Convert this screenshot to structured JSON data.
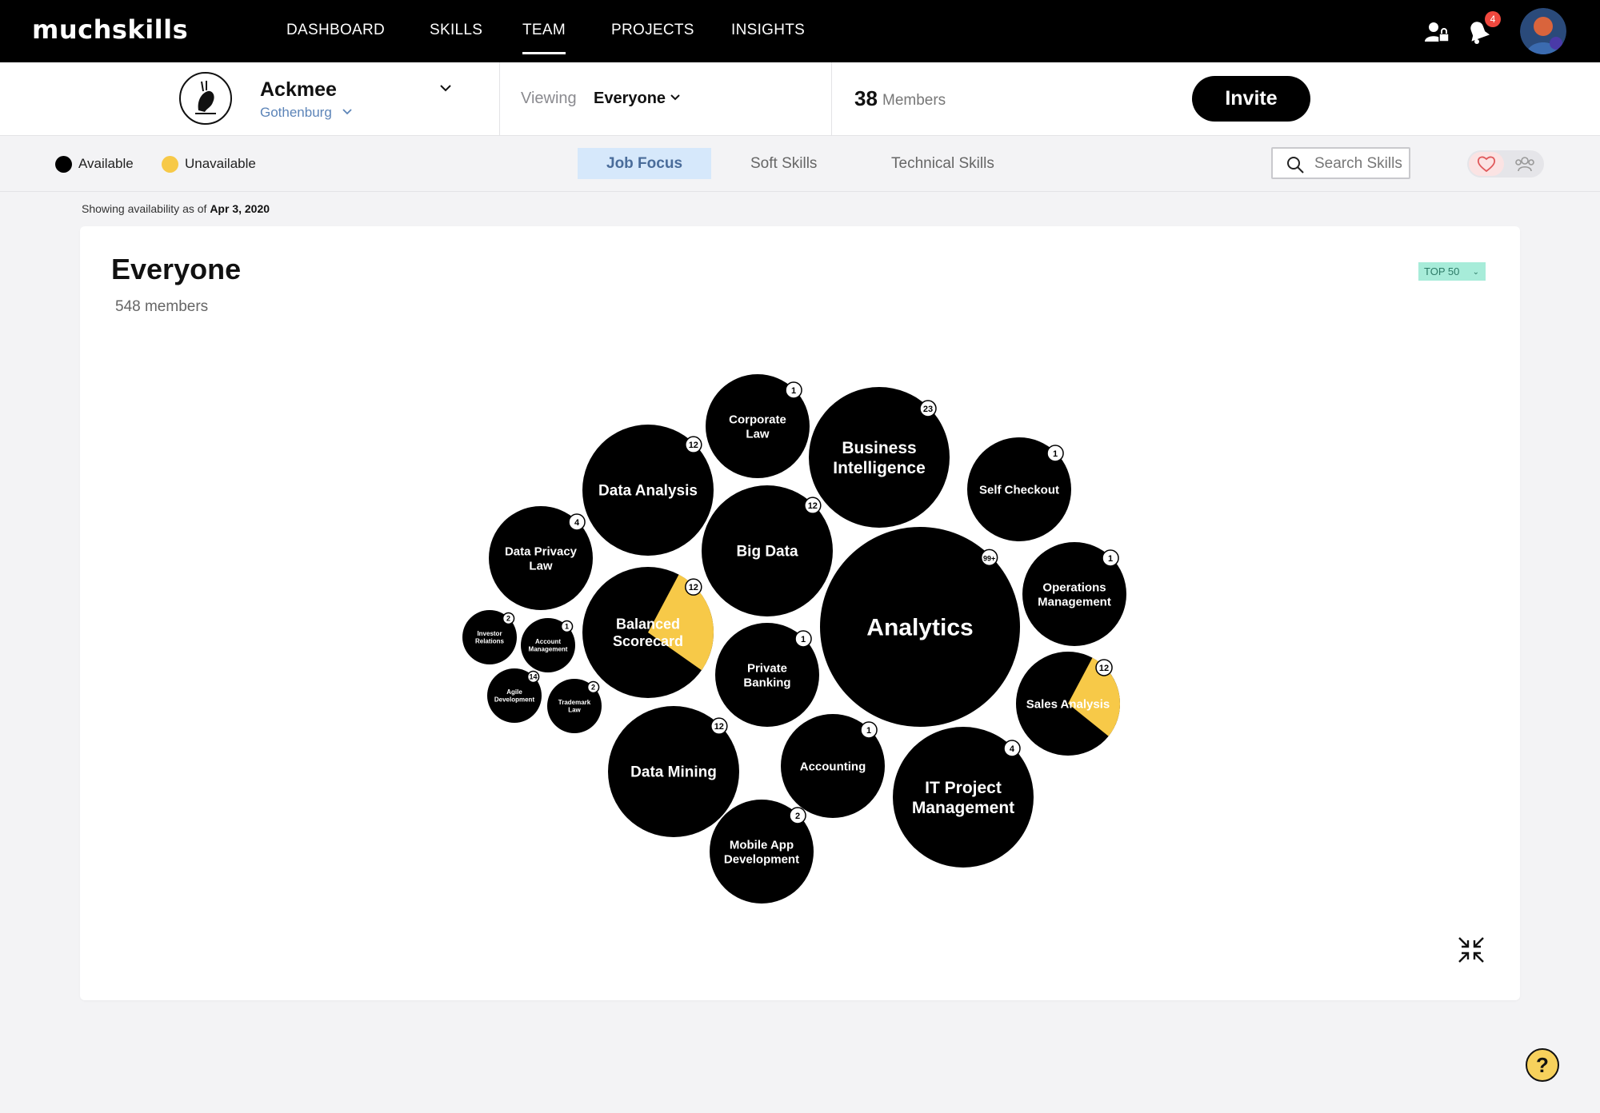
{
  "brand": {
    "logo_text": "muchskills"
  },
  "nav": {
    "items": [
      {
        "label": "DASHBOARD"
      },
      {
        "label": "SKILLS"
      },
      {
        "label": "TEAM"
      },
      {
        "label": "PROJECTS"
      },
      {
        "label": "INSIGHTS"
      }
    ],
    "active": "TEAM",
    "notification_count": "4"
  },
  "org": {
    "name": "Ackmee",
    "location": "Gothenburg",
    "viewing_label": "Viewing",
    "viewing_value": "Everyone",
    "members_count": "38",
    "members_label": "Members",
    "invite_label": "Invite"
  },
  "filters": {
    "legend": [
      {
        "label": "Available",
        "color": "#000000"
      },
      {
        "label": "Unavailable",
        "color": "#f7c948"
      }
    ],
    "tabs": [
      {
        "label": "Job Focus",
        "active": true
      },
      {
        "label": "Soft Skills",
        "active": false
      },
      {
        "label": "Technical Skills",
        "active": false
      }
    ],
    "search_placeholder": "Search Skills"
  },
  "availability": {
    "prefix": "Showing availability as of",
    "date": "Apr 3, 2020"
  },
  "card": {
    "title": "Everyone",
    "subtitle": "548 members",
    "top_filter": "TOP 50"
  },
  "colors": {
    "available": "#000000",
    "unavailable": "#f7c948",
    "accent_tab": "#d6e8fb",
    "badge": "#a7ecd9"
  },
  "bubbles": [
    {
      "label": "Analytics",
      "count": "99+",
      "unavailable_fraction": 0
    },
    {
      "label": "Business Intelligence",
      "count": "23",
      "unavailable_fraction": 0
    },
    {
      "label": "IT Project Management",
      "count": "4",
      "unavailable_fraction": 0
    },
    {
      "label": "Data Analysis",
      "count": "12",
      "unavailable_fraction": 0
    },
    {
      "label": "Big Data",
      "count": "12",
      "unavailable_fraction": 0
    },
    {
      "label": "Data Mining",
      "count": "12",
      "unavailable_fraction": 0
    },
    {
      "label": "Balanced Scorecard",
      "count": "12",
      "unavailable_fraction": 0.27
    },
    {
      "label": "Sales Analysis",
      "count": "12",
      "unavailable_fraction": 0.28
    },
    {
      "label": "Corporate Law",
      "count": "1",
      "unavailable_fraction": 0
    },
    {
      "label": "Self Checkout",
      "count": "1",
      "unavailable_fraction": 0
    },
    {
      "label": "Operations Management",
      "count": "1",
      "unavailable_fraction": 0
    },
    {
      "label": "Data Privacy Law",
      "count": "4",
      "unavailable_fraction": 0
    },
    {
      "label": "Private Banking",
      "count": "1",
      "unavailable_fraction": 0
    },
    {
      "label": "Accounting",
      "count": "1",
      "unavailable_fraction": 0
    },
    {
      "label": "Mobile App Development",
      "count": "2",
      "unavailable_fraction": 0
    },
    {
      "label": "Investor Relations",
      "count": "2",
      "unavailable_fraction": 0
    },
    {
      "label": "Account Management",
      "count": "1",
      "unavailable_fraction": 0
    },
    {
      "label": "Agile Development",
      "count": "14",
      "unavailable_fraction": 0
    },
    {
      "label": "Trademark Law",
      "count": "2",
      "unavailable_fraction": 0
    }
  ]
}
